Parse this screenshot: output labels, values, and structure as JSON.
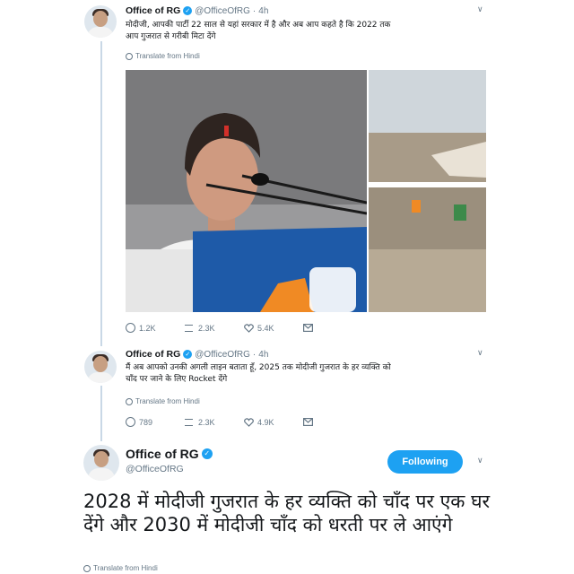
{
  "tweet1": {
    "name": "Office of RG",
    "handle": "@OfficeOfRG",
    "time": "4h",
    "text_line1": "मोदीजी, आपकी पार्टी 22 साल से यहां सरकार में है और अब आप कहते है कि 2022 तक",
    "text_line2": "आप गुजरात से गरीबी मिटा देंगे",
    "translate": "Translate from Hindi",
    "reply_count": "1.2K",
    "retweet_count": "2.3K",
    "like_count": "5.4K"
  },
  "tweet2": {
    "name": "Office of RG",
    "handle": "@OfficeOfRG",
    "time": "4h",
    "text_line1": "मैं अब आपको उनकी अगली लाइन बताता हूँ, 2025 तक मोदीजी गुजरात के हर व्यक्ति को",
    "text_line2": "चाँद पर जाने के लिए Rocket देंगे",
    "translate": "Translate from Hindi",
    "reply_count": "789",
    "retweet_count": "2.3K",
    "like_count": "4.9K"
  },
  "tweet3": {
    "name": "Office of RG",
    "handle": "@OfficeOfRG",
    "follow_label": "Following",
    "text": "2028 में मोदीजी गुजरात के हर व्यक्ति को चाँद पर एक घर देंगे और 2030 में मोदीजी चाँद को धरती पर ले आएंगे",
    "translate": "Translate from Hindi"
  },
  "icons": {
    "dot": "·",
    "chevron": "∨",
    "verified": "✓"
  },
  "colors": {
    "accent": "#1da1f2",
    "muted": "#657786",
    "thread_line": "#c9d8e6"
  }
}
